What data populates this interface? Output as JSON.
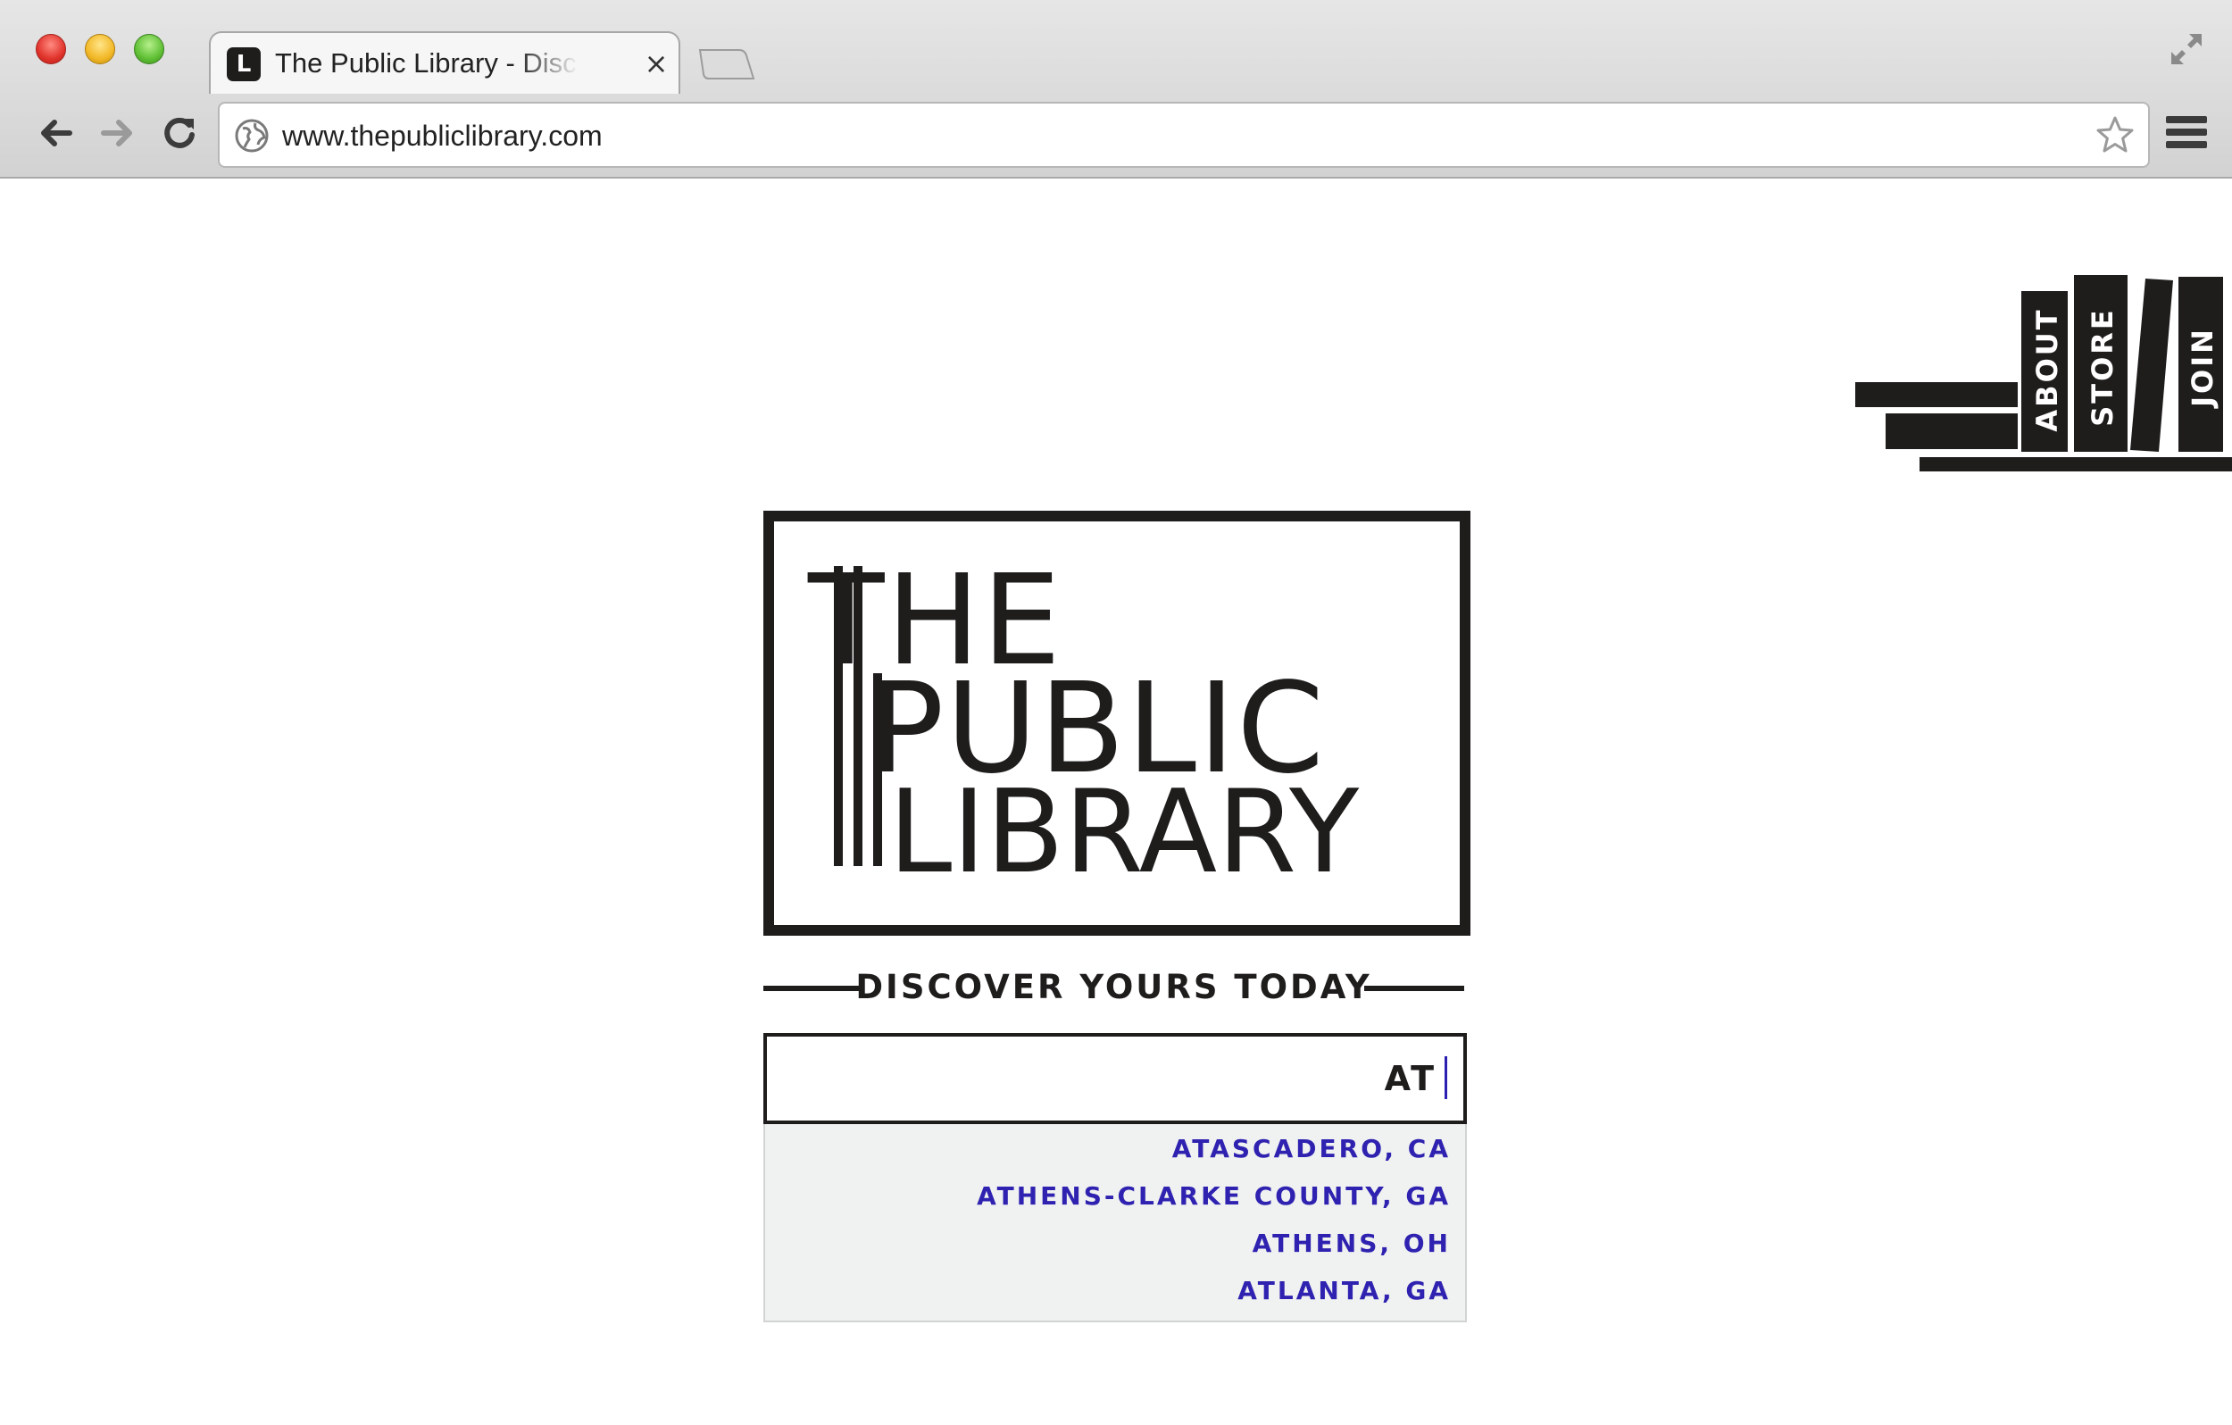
{
  "browser": {
    "tab": {
      "favicon_letter": "L",
      "title": "The Public Library - Discover",
      "close_glyph": "×"
    },
    "address_bar": {
      "url": "www.thepubliclibrary.com"
    }
  },
  "nav": {
    "about_label": "ABOUT",
    "store_label": "STORE",
    "join_label": "JOIN"
  },
  "logo": {
    "line1": "THE",
    "line2": "PUBLIC",
    "line3": "LIBRARY"
  },
  "tagline": "DISCOVER YOURS TODAY",
  "search": {
    "value": "AT"
  },
  "suggestions": [
    "ATASCADERO, CA",
    "ATHENS-CLARKE COUNTY, GA",
    "ATHENS, OH",
    "ATLANTA, GA"
  ],
  "colors": {
    "ink": "#1f1c1c",
    "suggestion_text": "#2f22b0",
    "suggestion_bg": "#f0f2f1"
  }
}
